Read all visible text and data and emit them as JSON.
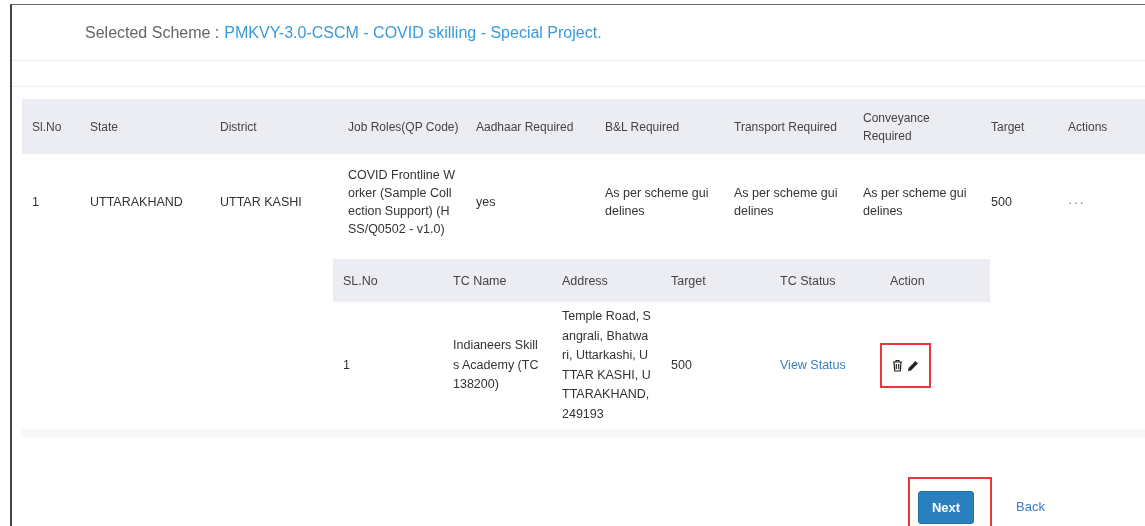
{
  "selected_scheme": {
    "label": "Selected Scheme :",
    "value": "PMKVY-3.0-CSCM - COVID skilling - Special Project."
  },
  "table": {
    "columns": [
      "Sl.No",
      "State",
      "District",
      "Job Roles(QP Code)",
      "Aadhaar Required",
      "B&L Required",
      "Transport Required",
      "Conveyance Required",
      "Target",
      "Actions"
    ],
    "rows": [
      {
        "cells": [
          "1",
          "UTTARAKHAND",
          "UTTAR KASHI",
          "COVID Frontline Worker (Sample Collection Support) (HSS/Q0502 - v1.0)",
          "yes",
          "As per scheme guidelines",
          "As per scheme guidelines",
          "As per scheme guidelines",
          "500"
        ],
        "actions": "···",
        "centers": {
          "columns": [
            "SL.No",
            "TC Name",
            "Address",
            "Target",
            "TC Status",
            "Action"
          ],
          "rows": [
            {
              "sl_no": "1",
              "tc_name": "Indianeers Skills Academy (TC138200)",
              "address": "Temple Road, Sangrali, Bhatwari, Uttarkashi, UTTAR KASHI, UTTARAKHAND, 249193",
              "target": "500",
              "status_link": "View Status",
              "actions_highlighted": true
            }
          ]
        }
      }
    ]
  },
  "buttons": {
    "next": {
      "label": "Next",
      "highlighted": true
    },
    "back": {
      "label": "Back"
    }
  }
}
